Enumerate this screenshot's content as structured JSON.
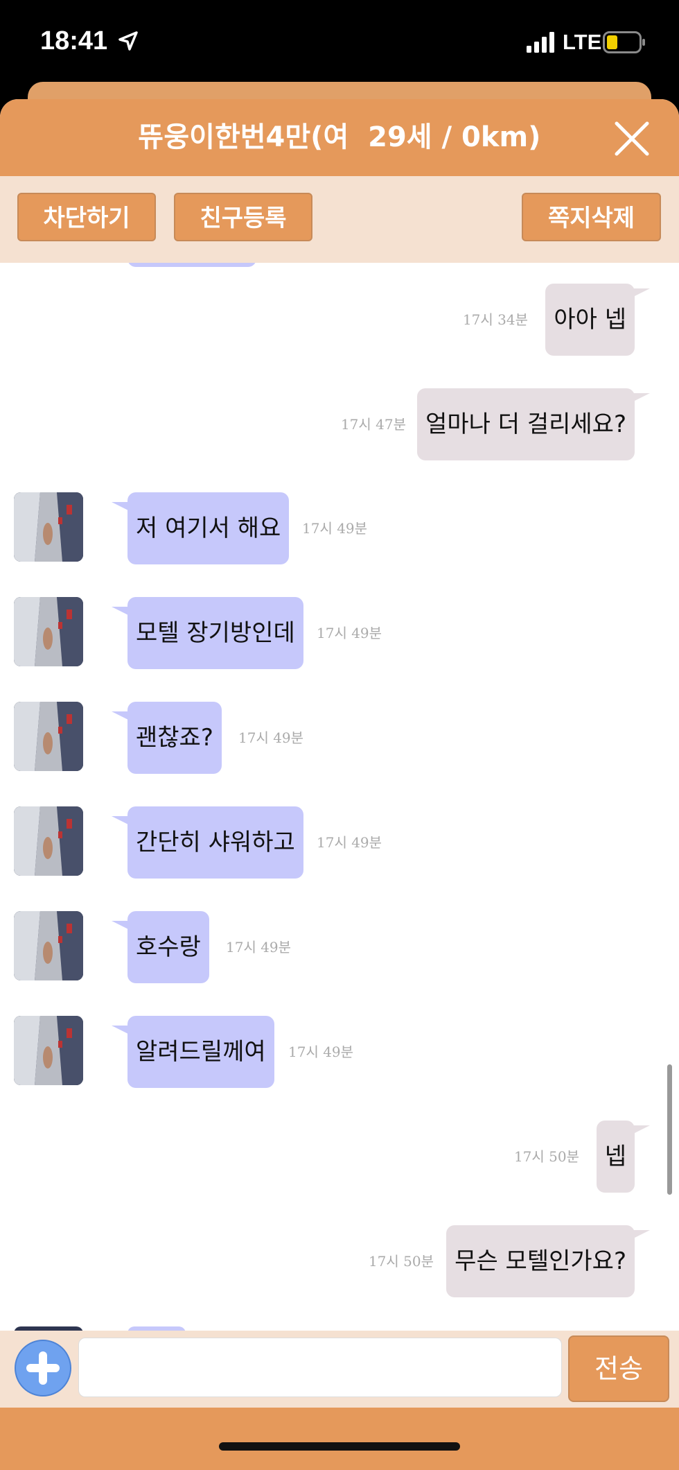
{
  "status_bar": {
    "time": "18:41",
    "network": "LTE"
  },
  "header": {
    "title": "뜌웅이한번4만(여  29세 / 0km)",
    "close_icon": "close-icon"
  },
  "actions": {
    "block": "차단하기",
    "add_friend": "친구등록",
    "delete_messages": "쪽지삭제"
  },
  "messages": [
    {
      "side": "out",
      "text": "아아 넵",
      "time": "17시 34분"
    },
    {
      "side": "out",
      "text": "얼마나 더 걸리세요?",
      "time": "17시 47분"
    },
    {
      "side": "in",
      "text": "저 여기서 해요",
      "time": "17시 49분"
    },
    {
      "side": "in",
      "text": "모텔 장기방인데",
      "time": "17시 49분"
    },
    {
      "side": "in",
      "text": "괜찮죠?",
      "time": "17시 49분"
    },
    {
      "side": "in",
      "text": "간단히 샤워하고",
      "time": "17시 49분"
    },
    {
      "side": "in",
      "text": "호수랑",
      "time": "17시 49분"
    },
    {
      "side": "in",
      "text": "알려드릴께여",
      "time": "17시 49분"
    },
    {
      "side": "out",
      "text": "넵",
      "time": "17시 50분"
    },
    {
      "side": "out",
      "text": "무슨 모텔인가요?",
      "time": "17시 50분"
    }
  ],
  "input": {
    "value": "",
    "placeholder": "",
    "send_label": "전송"
  },
  "colors": {
    "accent": "#e5995b",
    "action_bar_bg": "#f5e1d1",
    "incoming_bubble": "#c6c8fb",
    "outgoing_bubble": "#e6dee2",
    "plus_button": "#6fa2ef"
  }
}
